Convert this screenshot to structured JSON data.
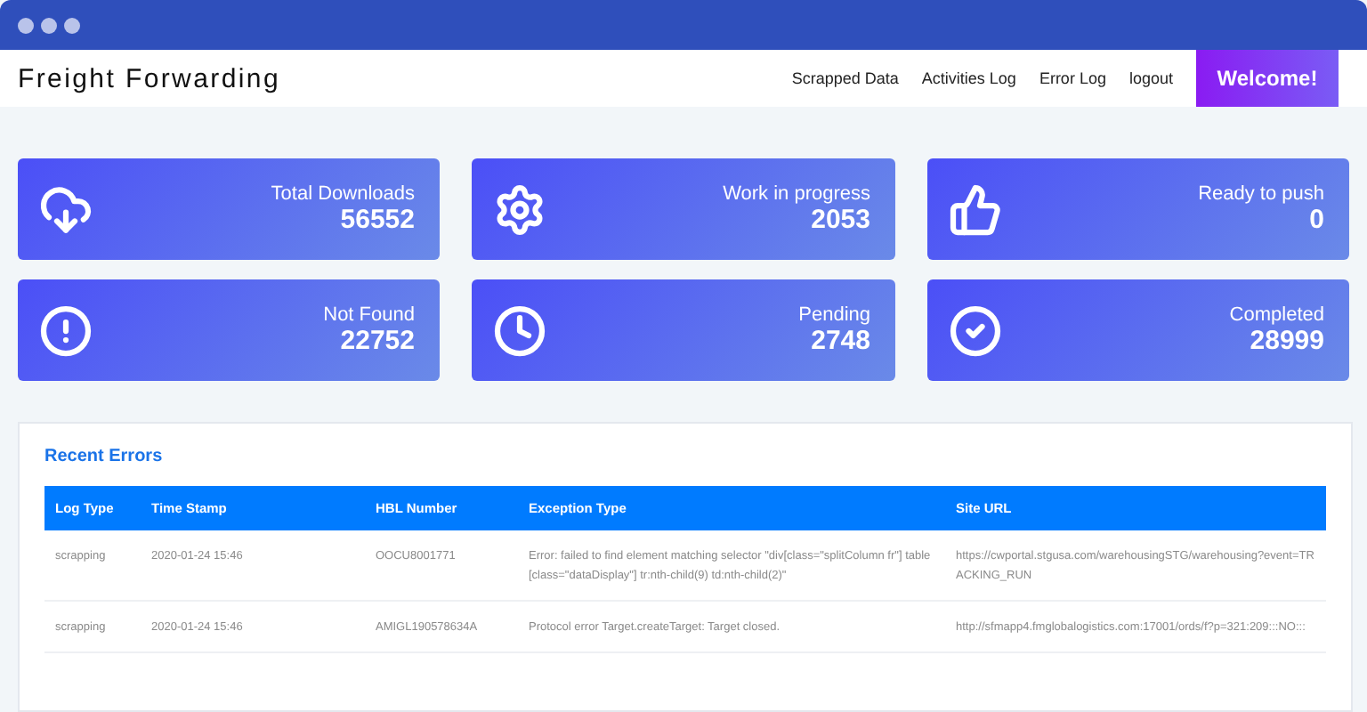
{
  "app": {
    "title": "Freight Forwarding"
  },
  "nav": {
    "links": [
      "Scrapped Data",
      "Activities Log",
      "Error Log",
      "logout"
    ],
    "welcome": "Welcome!"
  },
  "stats": [
    {
      "kind": "download",
      "label": "Total Downloads",
      "value": "56552"
    },
    {
      "kind": "gear",
      "label": "Work in progress",
      "value": "2053"
    },
    {
      "kind": "thumb",
      "label": "Ready to push",
      "value": "0"
    },
    {
      "kind": "alert",
      "label": "Not Found",
      "value": "22752"
    },
    {
      "kind": "clock",
      "label": "Pending",
      "value": "2748"
    },
    {
      "kind": "check",
      "label": "Completed",
      "value": "28999"
    }
  ],
  "recent_errors": {
    "title": "Recent Errors",
    "columns": [
      "Log Type",
      "Time Stamp",
      "HBL Number",
      "Exception Type",
      "Site URL"
    ],
    "rows": [
      [
        "scrapping",
        "2020-01-24 15:46",
        "OOCU8001771",
        "Error: failed to find element matching selector \"div[class=\"splitColumn fr\"] table[class=\"dataDisplay\"] tr:nth-child(9) td:nth-child(2)\"",
        "https://cwportal.stgusa.com/warehousingSTG/warehousing?event=TRACKING_RUN"
      ],
      [
        "scrapping",
        "2020-01-24 15:46",
        "AMIGL190578634A",
        "Protocol error Target.createTarget: Target closed.",
        "http://sfmapp4.fmglobalogistics.com:17001/ords/f?p=321:209:::NO:::"
      ]
    ]
  }
}
